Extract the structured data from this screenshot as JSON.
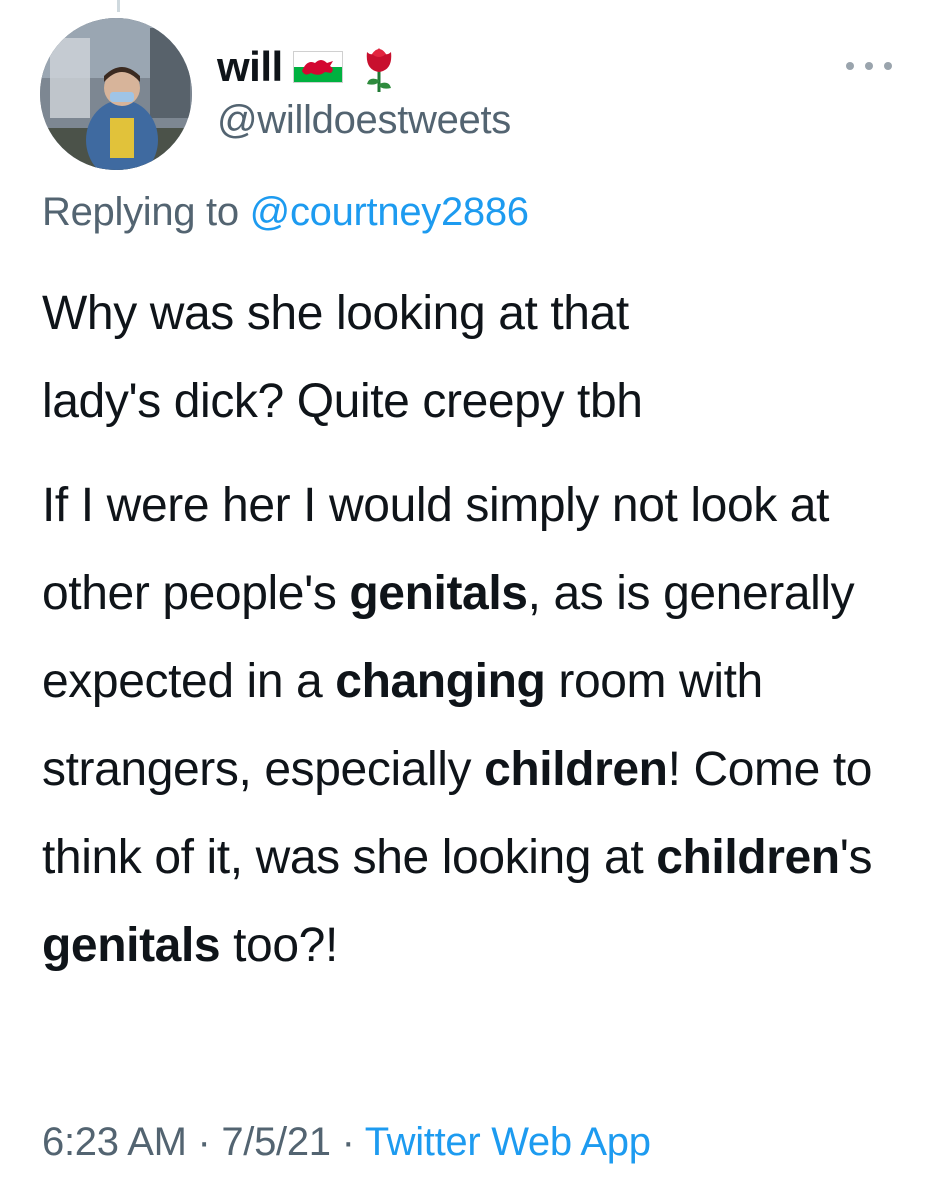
{
  "tweet": {
    "author": {
      "display_name": "will",
      "handle": "@willdoestweets",
      "avatar_icon": "profile-photo",
      "name_emoji": [
        "welsh-flag-icon",
        "rose-icon"
      ]
    },
    "more_icon": "more-dots-icon",
    "reply_context": {
      "prefix": "Replying to ",
      "mention": "@courtney2886"
    },
    "paragraph1": {
      "line1": "Why was she looking at that",
      "line2": "lady's dick? Quite creepy tbh"
    },
    "paragraph2": {
      "seg1": "If I were her I would simply not look at other people's ",
      "bold_genitals_1": "genitals",
      "seg2": ", as is generally expected in a ",
      "bold_changing": "changing",
      "seg3": " room with strangers, especially ",
      "bold_children_1": "children",
      "seg4": "! Come to think of it, was she looking at ",
      "bold_children_2": "children",
      "seg5": "'s ",
      "bold_genitals_2": "genitals",
      "seg6": " too?!"
    },
    "timestamp": "6:23 AM",
    "separator": " · ",
    "date": "7/5/21",
    "source": "Twitter Web App"
  },
  "colors": {
    "text": "#0f1419",
    "secondary": "#536471",
    "link": "#1d9bf0",
    "flag_red": "#d30731",
    "flag_green": "#00b140",
    "rose_red": "#c8102e"
  }
}
